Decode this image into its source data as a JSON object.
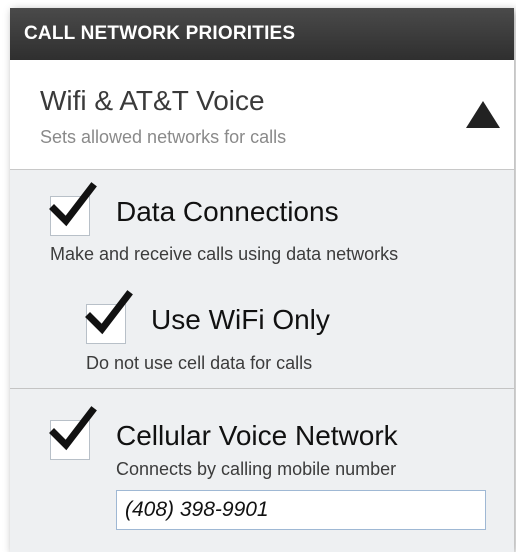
{
  "header": {
    "title": "CALL NETWORK PRIORITIES"
  },
  "mode": {
    "title": "Wifi & AT&T Voice",
    "subtitle": "Sets allowed networks for calls",
    "expanded": true
  },
  "options": {
    "data_connections": {
      "label": "Data Connections",
      "description": "Make and receive calls using data networks",
      "checked": true
    },
    "use_wifi_only": {
      "label": "Use WiFi Only",
      "description": "Do not use cell data for calls",
      "checked": true
    },
    "cellular_voice": {
      "label": "Cellular Voice Network",
      "description": "Connects by calling mobile number",
      "checked": true,
      "phone_number": "(408) 398-9901"
    }
  },
  "colors": {
    "header_bg": "#3a3a3a",
    "panel_bg": "#eef0f2",
    "check": "#111111",
    "input_border": "#9fb8d4"
  },
  "icons": {
    "collapse": "triangle-up-icon",
    "check": "checkmark-icon"
  }
}
